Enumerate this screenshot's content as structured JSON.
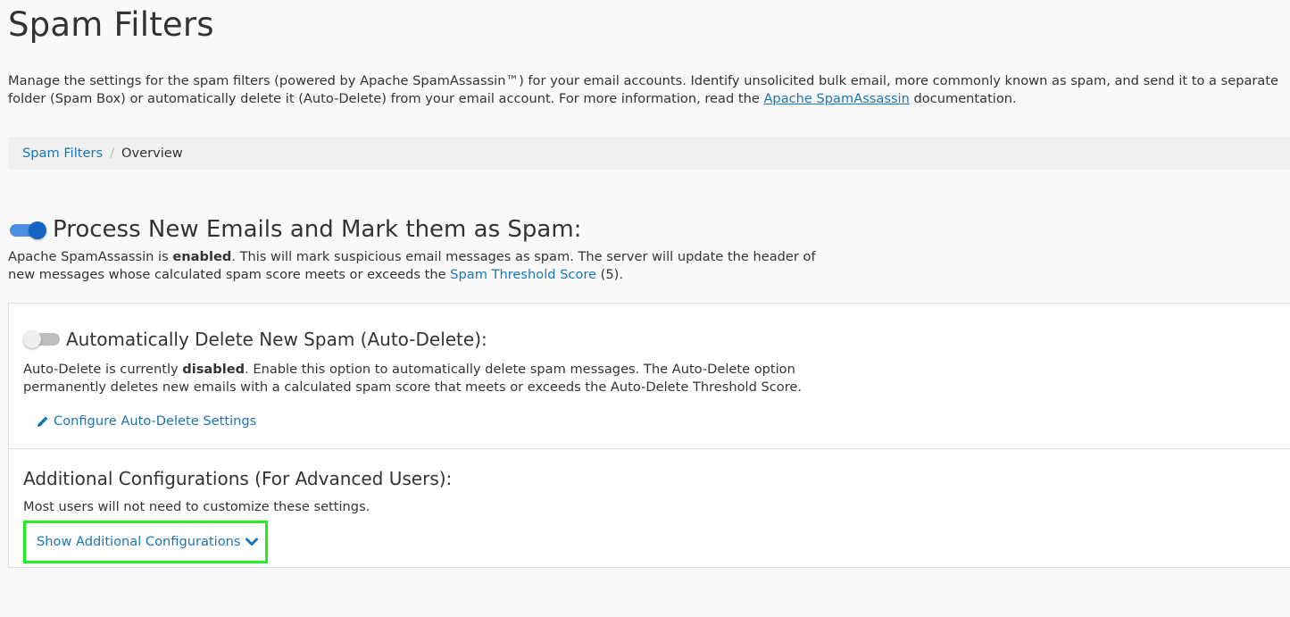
{
  "page": {
    "title": "Spam Filters",
    "intro": {
      "before_link": "Manage the settings for the spam filters (powered by Apache SpamAssassin™) for your email accounts. Identify unsolicited bulk email, more commonly known as spam, and send it to a separate folder (Spam Box) or automatically delete it (Auto-Delete) from your email account. For more information, read the ",
      "link_text": "Apache SpamAssassin",
      "after_link": " documentation."
    }
  },
  "breadcrumb": {
    "parent": "Spam Filters",
    "separator": "/",
    "current": "Overview"
  },
  "process_section": {
    "toggle_state": "on",
    "heading": "Process New Emails and Mark them as Spam:",
    "text_before": "Apache SpamAssassin is ",
    "status": "enabled",
    "text_after": ". This will mark suspicious email messages as spam. The server will update the header of new messages whose calculated spam score meets or exceeds the ",
    "threshold_link": "Spam Threshold Score",
    "threshold_value": " (5)."
  },
  "auto_delete_section": {
    "toggle_state": "off",
    "heading": "Automatically Delete New Spam (Auto-Delete):",
    "text_before": "Auto-Delete is currently ",
    "status": "disabled",
    "text_after": ". Enable this option to automatically delete spam messages. The Auto-Delete option permanently deletes new emails with a calculated spam score that meets or exceeds the Auto-Delete Threshold Score.",
    "config_link": "Configure Auto-Delete Settings",
    "config_icon": "pencil-icon"
  },
  "additional_section": {
    "heading": "Additional Configurations (For Advanced Users):",
    "text": "Most users will not need to customize these settings.",
    "show_link": "Show Additional Configurations",
    "show_icon": "chevron-down-icon"
  },
  "colors": {
    "link": "#1a76b4",
    "toggle_on": "#1565c0",
    "highlight": "#22ee22"
  }
}
